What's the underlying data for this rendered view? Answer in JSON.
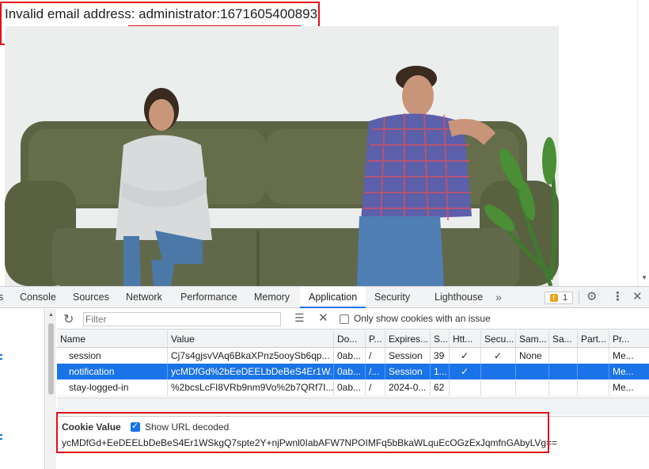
{
  "page": {
    "error_prefix": "Invalid email address: ",
    "error_value": "administrator:1671605400893"
  },
  "devtools": {
    "tabs": [
      {
        "label": "s"
      },
      {
        "label": "Console"
      },
      {
        "label": "Sources"
      },
      {
        "label": "Network"
      },
      {
        "label": "Performance"
      },
      {
        "label": "Memory"
      },
      {
        "label": "Application"
      },
      {
        "label": "Security"
      },
      {
        "label": "Lighthouse"
      }
    ],
    "more_tabs": "»",
    "issues_count": "1",
    "icons": {
      "settings": "gear-icon",
      "menu": "more-vert-icon",
      "close": "close-icon",
      "refresh": "refresh-icon",
      "clear": "clear-filtered-icon",
      "delete": "delete-icon",
      "warning": "warning-icon"
    },
    "toolbar": {
      "filter_placeholder": "Filter",
      "only_issues_label": "Only show cookies with an issue"
    },
    "table": {
      "headers": [
        "Name",
        "Value",
        "Do...",
        "P...",
        "Expires...",
        "S...",
        "Htt...",
        "Secu...",
        "Sam...",
        "Sa...",
        "Part...",
        "Pr..."
      ],
      "rows": [
        [
          "session",
          "Cj7s4gjsvVAq6BkaXPnz5ooySb6qp...",
          "0ab...",
          "/",
          "Session",
          "39",
          "✓",
          "✓",
          "None",
          "",
          "",
          "Me..."
        ],
        [
          "notification",
          "ycMDfGd%2bEeDEELbDeBeS4Er1W...",
          "0ab...",
          "/...",
          "Session",
          "1...",
          "✓",
          "",
          "",
          "",
          "",
          "Me..."
        ],
        [
          "stay-logged-in",
          "%2bcsLcFI8VRb9nm9Vo%2b7QRf7I...",
          "0ab...",
          "/",
          "2024-0...",
          "62",
          "",
          "",
          "",
          "",
          "",
          "Me..."
        ]
      ],
      "selected_row": 1
    },
    "cookie_pane": {
      "title": "Cookie Value",
      "show_decoded_label": "Show URL decoded",
      "value": "ycMDfGd+EeDEELbDeBeS4Er1WSkgQ7spte2Y+njPwnl0IabAFW7NPOIMFq5bBkaWLquEcOGzExJqmfnGAbyLVg=="
    },
    "accent_color": "#1a73e8",
    "highlight_color": "#e0101b"
  }
}
